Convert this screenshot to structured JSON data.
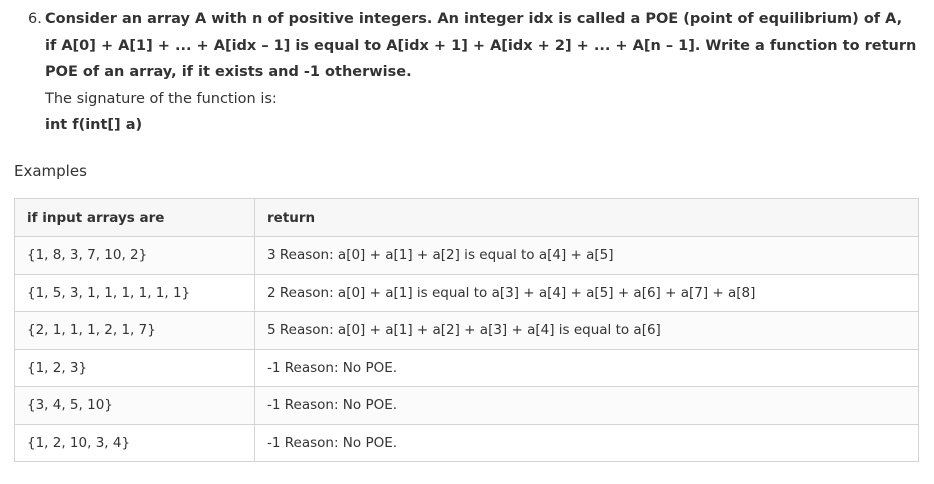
{
  "question": {
    "number": "6.",
    "text": "Consider an array A with n of positive integers. An integer idx is called a POE (point of equilibrium) of A, if A[0] + A[1] + ... + A[idx – 1] is equal to A[idx + 1] + A[idx + 2] + ... + A[n – 1]. Write a function to return POE of an array, if it exists and -1 otherwise.",
    "signature_intro": "The signature of the function is:",
    "signature": "int f(int[] a)"
  },
  "examples": {
    "heading": "Examples",
    "headers": [
      "if input arrays are",
      "return"
    ],
    "rows": [
      [
        "{1, 8, 3, 7, 10, 2}",
        "3 Reason: a[0] + a[1] + a[2] is equal to a[4] + a[5]"
      ],
      [
        "{1, 5, 3, 1, 1, 1, 1, 1, 1}",
        "2 Reason: a[0] + a[1] is equal to a[3] + a[4] + a[5] + a[6] + a[7] + a[8]"
      ],
      [
        "{2, 1, 1, 1, 2, 1, 7}",
        "5 Reason: a[0] + a[1] + a[2] + a[3] + a[4] is equal to a[6]"
      ],
      [
        "{1, 2, 3}",
        "-1 Reason: No POE."
      ],
      [
        "{3, 4, 5, 10}",
        "-1 Reason: No POE."
      ],
      [
        "{1, 2, 10, 3, 4}",
        "-1 Reason: No POE."
      ]
    ]
  }
}
